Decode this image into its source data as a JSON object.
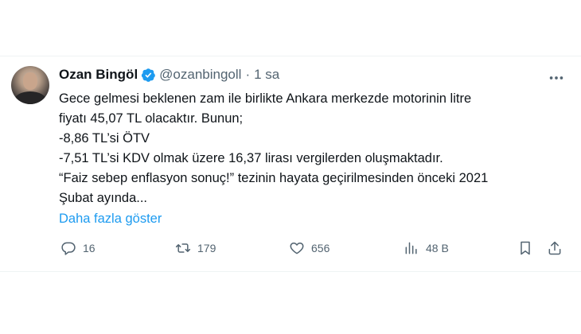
{
  "user": {
    "name": "Ozan Bingöl",
    "handle": "@ozanbingoll",
    "separator": "·",
    "time": "1 sa"
  },
  "tweet": {
    "lines": [
      "Gece gelmesi beklenen zam ile birlikte Ankara merkezde motorinin litre",
      "fiyatı 45,07 TL olacaktır. Bunun;",
      "-8,86 TL’si ÖTV",
      "-7,51 TL’si KDV olmak üzere 16,37 lirası vergilerden oluşmaktadır.",
      "“Faiz sebep enflasyon sonuç!” tezinin hayata geçirilmesinden önceki 2021",
      "Şubat ayında..."
    ],
    "show_more": "Daha fazla göster"
  },
  "actions": {
    "replies": "16",
    "retweets": "179",
    "likes": "656",
    "views": "48 B"
  },
  "icons": {
    "verified": "verified-badge-icon",
    "more": "more-dots-icon",
    "reply": "reply-icon",
    "retweet": "retweet-icon",
    "like": "heart-icon",
    "views": "views-bar-chart-icon",
    "bookmark": "bookmark-icon",
    "share": "share-icon"
  },
  "colors": {
    "accent": "#1d9bf0",
    "muted": "#536471",
    "text": "#0f1419"
  }
}
